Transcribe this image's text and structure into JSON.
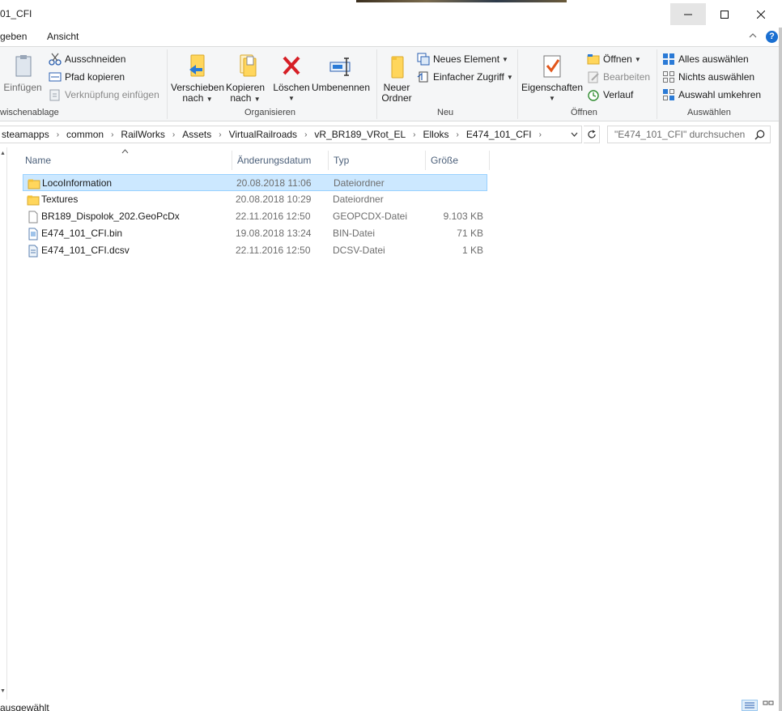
{
  "window": {
    "title": "01_CFI",
    "minimize_icon": "minimize-icon",
    "maximize_icon": "maximize-icon",
    "close_icon": "close-icon"
  },
  "menu": {
    "tabs": [
      {
        "label": "geben"
      },
      {
        "label": "Ansicht"
      }
    ],
    "collapse_icon": "chevron-up-icon",
    "help_icon": "help-icon",
    "help_symbol": "?"
  },
  "ribbon": {
    "clipboard": {
      "paste_label": "Einfügen",
      "cut_label": "Ausschneiden",
      "copy_path_label": "Pfad kopieren",
      "paste_shortcut_label": "Verknüpfung einfügen",
      "group_label": "wischenablage"
    },
    "organize": {
      "move_label_1": "Verschieben",
      "move_label_2": "nach",
      "copy_label_1": "Kopieren",
      "copy_label_2": "nach",
      "delete_label": "Löschen",
      "rename_label": "Umbenennen",
      "group_label": "Organisieren"
    },
    "new": {
      "new_folder_label_1": "Neuer",
      "new_folder_label_2": "Ordner",
      "new_item_label": "Neues Element",
      "easy_access_label": "Einfacher Zugriff",
      "group_label": "Neu"
    },
    "open": {
      "properties_label": "Eigenschaften",
      "open_label": "Öffnen",
      "edit_label": "Bearbeiten",
      "history_label": "Verlauf",
      "group_label": "Öffnen"
    },
    "select": {
      "select_all_label": "Alles auswählen",
      "select_none_label": "Nichts auswählen",
      "invert_label": "Auswahl umkehren",
      "group_label": "Auswählen"
    }
  },
  "address": {
    "crumbs": [
      "steamapps",
      "common",
      "RailWorks",
      "Assets",
      "VirtualRailroads",
      "vR_BR189_VRot_EL",
      "Elloks",
      "E474_101_CFI"
    ],
    "separator": "›",
    "search_placeholder": "\"E474_101_CFI\" durchsuchen"
  },
  "filelist": {
    "columns": {
      "name": "Name",
      "date": "Änderungsdatum",
      "type": "Typ",
      "size": "Größe"
    },
    "rows": [
      {
        "name": "LocoInformation",
        "date": "20.08.2018 11:06",
        "type": "Dateiordner",
        "size": "",
        "icon": "folder-icon",
        "selected": true
      },
      {
        "name": "Textures",
        "date": "20.08.2018 10:29",
        "type": "Dateiordner",
        "size": "",
        "icon": "folder-icon",
        "selected": false
      },
      {
        "name": "BR189_Dispolok_202.GeoPcDx",
        "date": "22.11.2016 12:50",
        "type": "GEOPCDX-Datei",
        "size": "9.103 KB",
        "icon": "file-icon",
        "selected": false
      },
      {
        "name": "E474_101_CFI.bin",
        "date": "19.08.2018 13:24",
        "type": "BIN-Datei",
        "size": "71 KB",
        "icon": "bin-file-icon",
        "selected": false
      },
      {
        "name": "E474_101_CFI.dcsv",
        "date": "22.11.2016 12:50",
        "type": "DCSV-Datei",
        "size": "1 KB",
        "icon": "dcsv-file-icon",
        "selected": false
      }
    ]
  },
  "status": {
    "text": "ausgewählt"
  },
  "colors": {
    "selection_bg": "#cce8ff",
    "selection_border": "#99d1ff",
    "folder_yellow": "#ffd65c",
    "delete_red": "#d61f26",
    "accent_blue": "#1a6fd1"
  }
}
